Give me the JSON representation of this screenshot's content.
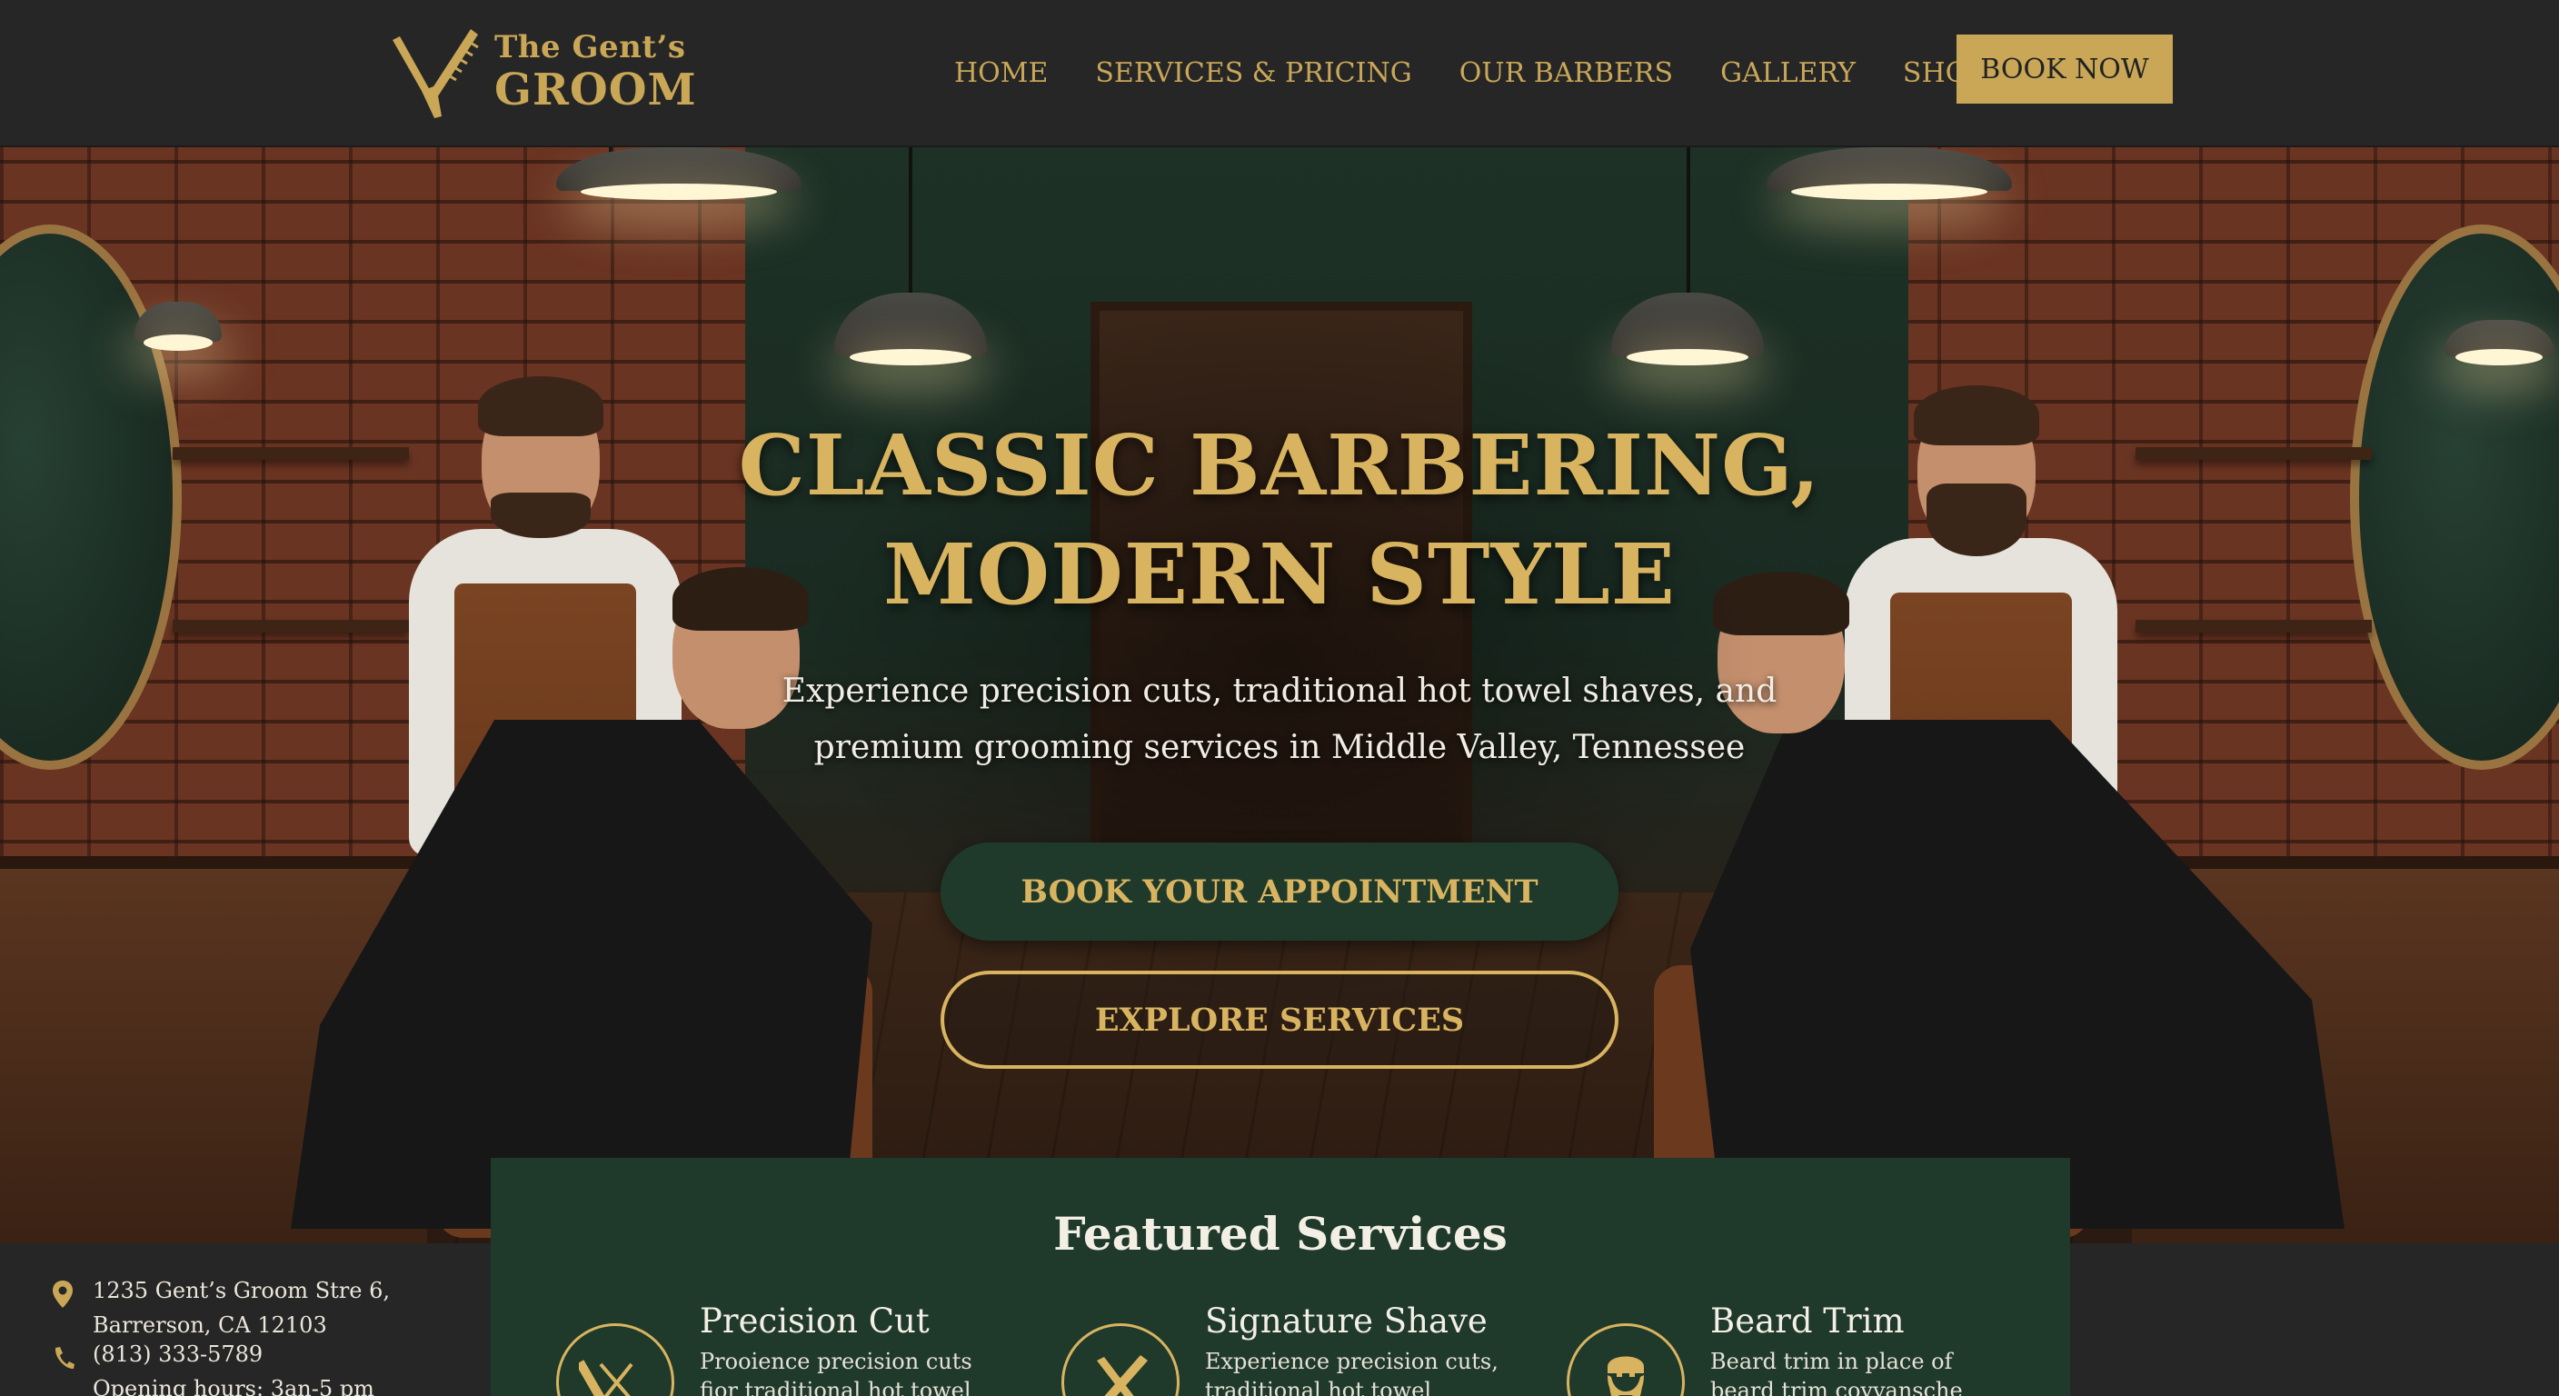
{
  "brand": {
    "name_line1": "The Gent’s",
    "name_line2": "GROOM"
  },
  "nav": {
    "items": [
      {
        "label": "HOME"
      },
      {
        "label": "SERVICES & PRICING"
      },
      {
        "label": "OUR BARBERS"
      },
      {
        "label": "GALLERY"
      },
      {
        "label": "SHOP"
      }
    ],
    "cta_label": "BOOK NOW"
  },
  "hero": {
    "title_line1": "CLASSIC BARBERING,",
    "title_line2": "MODERN STYLE",
    "subtitle_line1": "Experience precision cuts, traditional hot towel shaves, and",
    "subtitle_line2": "premium grooming services in Middle Valley, Tennessee",
    "primary_button": "BOOK YOUR APPOINTMENT",
    "secondary_button": "EXPLORE SERVICES"
  },
  "contact": {
    "address_line1": "1235 Gent’s Groom Stre 6,",
    "address_line2": "Barrerson, CA 12103",
    "phone": "(813) 333-5789",
    "hours": "Opening hours: 3an-5 pm"
  },
  "featured": {
    "title": "Featured Services",
    "services": [
      {
        "name": "Precision Cut",
        "desc": "Prooience precision cuts fior traditional hot towel shaves.",
        "icon": "comb-scissors-icon"
      },
      {
        "name": "Signature Shave",
        "desc": "Experience precision cuts, traditional hot towel shaves.",
        "icon": "razor-comb-icon"
      },
      {
        "name": "Beard Trim",
        "desc": "Beard trim in place of beard trim coyvansche teraon.",
        "icon": "bearded-face-icon"
      }
    ]
  },
  "colors": {
    "header_bg": "#262626",
    "gold": "#c9a757",
    "hero_gold": "#d9b460",
    "forest_green": "#1f3a2b"
  }
}
